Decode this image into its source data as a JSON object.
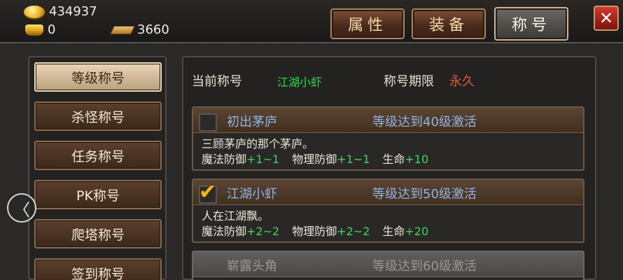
{
  "resources": {
    "gold": "434937",
    "ingot": "0",
    "scroll": "3660"
  },
  "tabs": [
    {
      "label": "属性",
      "active": false
    },
    {
      "label": "装备",
      "active": false
    },
    {
      "label": "称号",
      "active": true
    }
  ],
  "close_label": "✕",
  "categories": [
    {
      "label": "等级称号",
      "active": true
    },
    {
      "label": "杀怪称号",
      "active": false
    },
    {
      "label": "任务称号",
      "active": false
    },
    {
      "label": "PK称号",
      "active": false
    },
    {
      "label": "爬塔称号",
      "active": false
    },
    {
      "label": "签到称号",
      "active": false
    }
  ],
  "arrow_label": "〈",
  "current": {
    "label": "当前称号",
    "value": "江湖小虾",
    "period_label": "称号期限",
    "period_value": "永久"
  },
  "titles": [
    {
      "name": "初出茅庐",
      "condition": "等级达到40级激活",
      "desc": "三顾茅庐的那个茅庐。",
      "stats": [
        {
          "label": "魔法防御",
          "value": "+1~1"
        },
        {
          "label": "物理防御",
          "value": "+1~1"
        },
        {
          "label": "生命",
          "value": "+10"
        }
      ],
      "checked": false
    },
    {
      "name": "江湖小虾",
      "condition": "等级达到50级激活",
      "desc": "人在江湖飘。",
      "stats": [
        {
          "label": "魔法防御",
          "value": "+2~2"
        },
        {
          "label": "物理防御",
          "value": "+2~2"
        },
        {
          "label": "生命",
          "value": "+20"
        }
      ],
      "checked": true
    },
    {
      "name": "崭露头角",
      "condition": "等级达到60级激活",
      "locked": true
    }
  ]
}
